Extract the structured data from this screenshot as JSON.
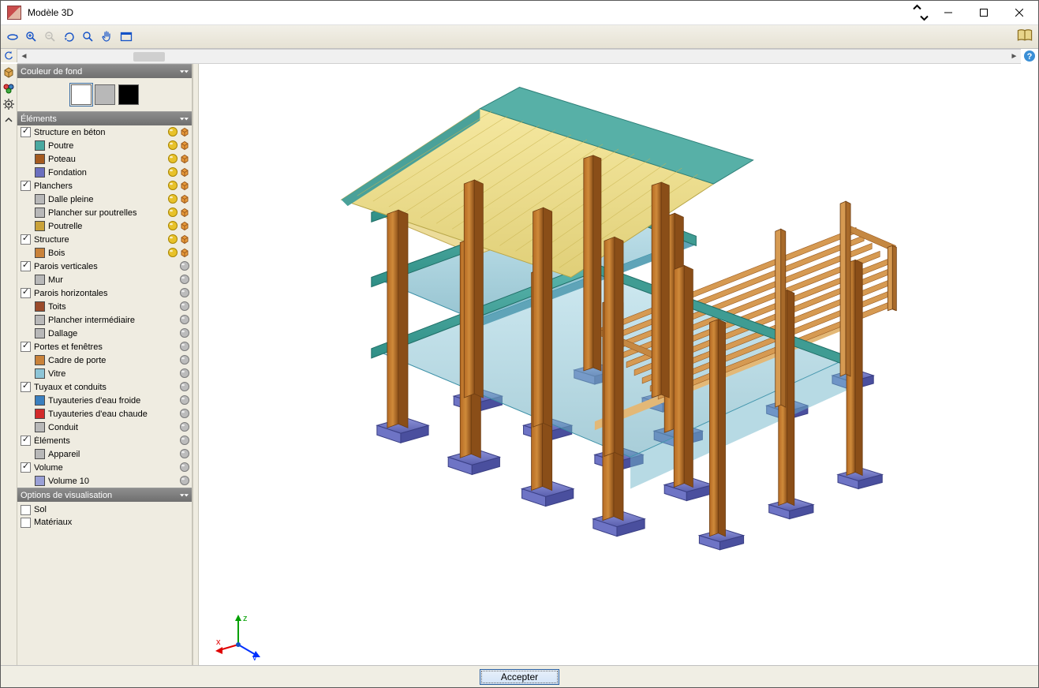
{
  "window": {
    "title": "Modèle 3D"
  },
  "toolbar": {
    "items": [
      {
        "name": "orbit",
        "hint": "Orbit"
      },
      {
        "name": "zoom-window",
        "hint": "Zoom window"
      },
      {
        "name": "zoom-prev",
        "hint": "Zoom previous",
        "disabled": true
      },
      {
        "name": "redraw",
        "hint": "Redraw"
      },
      {
        "name": "zoom",
        "hint": "Zoom"
      },
      {
        "name": "pan",
        "hint": "Pan"
      },
      {
        "name": "print",
        "hint": "Frame window"
      }
    ]
  },
  "leftStrip": {
    "items": [
      {
        "name": "rotate-ccw-icon"
      },
      {
        "name": "cube-icon"
      },
      {
        "name": "sun-icon"
      },
      {
        "name": "chevron-up-icon"
      }
    ]
  },
  "panels": {
    "background": {
      "title": "Couleur de fond",
      "colors": [
        "#ffffff",
        "#b8b8b8",
        "#000000"
      ],
      "selectedIndex": 0
    },
    "elements": {
      "title": "Éléments",
      "groups": [
        {
          "label": "Structure en béton",
          "checked": true,
          "yellowCube": true,
          "children": [
            {
              "label": "Poutre",
              "color": "#4aa9a0",
              "yellowCube": true
            },
            {
              "label": "Poteau",
              "color": "#a45a1f",
              "yellowCube": true
            },
            {
              "label": "Fondation",
              "color": "#6b6fbf",
              "yellowCube": true
            }
          ]
        },
        {
          "label": "Planchers",
          "checked": true,
          "yellowCube": true,
          "children": [
            {
              "label": "Dalle pleine",
              "color": "#b8b8b8",
              "yellowCube": true
            },
            {
              "label": "Plancher sur poutrelles",
              "color": "#b8b8b8",
              "yellowCube": true
            },
            {
              "label": "Poutrelle",
              "color": "#c9a23a",
              "yellowCube": true
            }
          ]
        },
        {
          "label": "Structure",
          "checked": true,
          "yellowCube": true,
          "children": [
            {
              "label": "Bois",
              "color": "#c9823a",
              "yellowCube": true
            }
          ]
        },
        {
          "label": "Parois verticales",
          "checked": true,
          "grey": true,
          "children": [
            {
              "label": "Mur",
              "color": "#b8b8b8",
              "grey": true
            }
          ]
        },
        {
          "label": "Parois horizontales",
          "checked": true,
          "grey": true,
          "children": [
            {
              "label": "Toits",
              "color": "#9a4a2a",
              "grey": true
            },
            {
              "label": "Plancher intermédiaire",
              "color": "#b8b8b8",
              "grey": true
            },
            {
              "label": "Dallage",
              "color": "#b8b8b8",
              "grey": true
            }
          ]
        },
        {
          "label": "Portes et fenêtres",
          "checked": true,
          "grey": true,
          "children": [
            {
              "label": "Cadre de porte",
              "color": "#c9823a",
              "grey": true
            },
            {
              "label": "Vitre",
              "color": "#8dc5d7",
              "grey": true
            }
          ]
        },
        {
          "label": "Tuyaux et conduits",
          "checked": true,
          "grey": true,
          "children": [
            {
              "label": "Tuyauteries d'eau froide",
              "color": "#3a7fbf",
              "grey": true
            },
            {
              "label": "Tuyauteries d'eau chaude",
              "color": "#d22a2a",
              "grey": true
            },
            {
              "label": "Conduit",
              "color": "#b8b8b8",
              "grey": true
            }
          ]
        },
        {
          "label": "Éléments",
          "checked": true,
          "grey": true,
          "children": [
            {
              "label": "Appareil",
              "color": "#b8b8b8",
              "grey": true
            }
          ]
        },
        {
          "label": "Volume",
          "checked": true,
          "grey": true,
          "children": [
            {
              "label": "Volume 10",
              "color": "#9aa0d6",
              "grey": true
            }
          ]
        }
      ]
    },
    "visOptions": {
      "title": "Options de visualisation",
      "items": [
        {
          "label": "Sol",
          "checked": false
        },
        {
          "label": "Matériaux",
          "checked": false
        }
      ]
    }
  },
  "axis": {
    "x": "x",
    "y": "y",
    "z": "z"
  },
  "footer": {
    "accept": "Accepter"
  }
}
